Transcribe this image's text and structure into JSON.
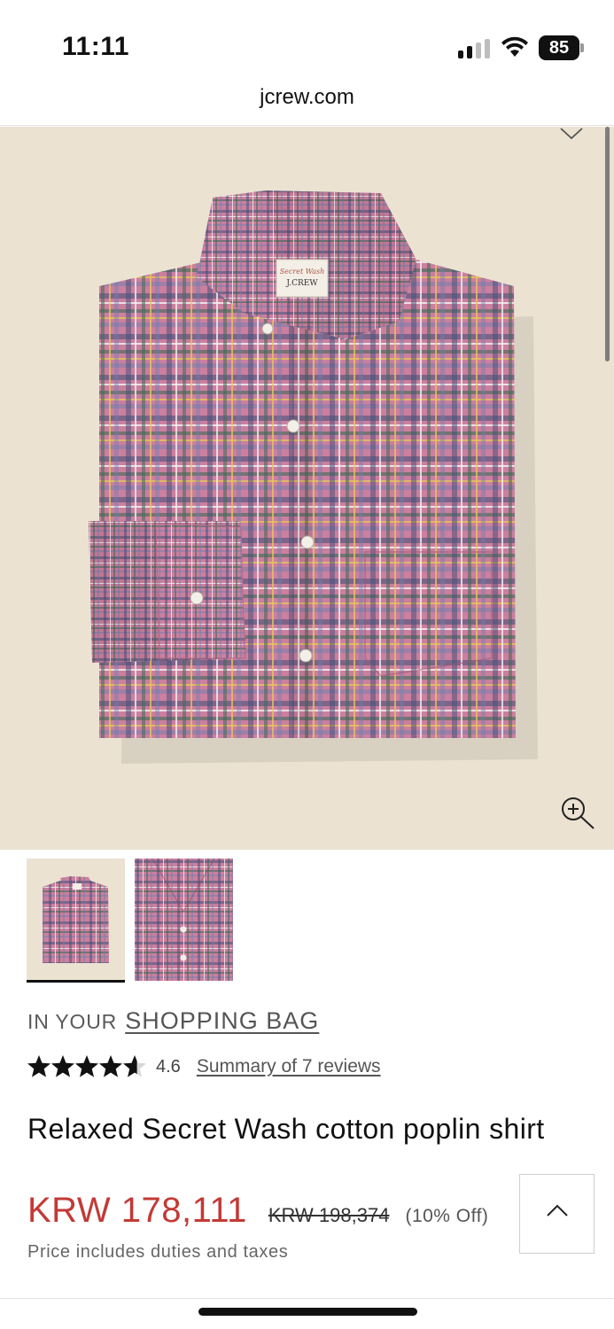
{
  "status_bar": {
    "time": "11:11",
    "battery": "85"
  },
  "browser": {
    "url": "jcrew.com"
  },
  "hero": {
    "label_line1": "Secret Wash",
    "label_line2": "J.CREW",
    "colors": {
      "background": "#ebe2d2",
      "plaid_base": "#cc7f9e",
      "plaid_navy": "#3f4f78",
      "plaid_green": "#3d6b55",
      "plaid_white": "#f4eff0",
      "plaid_yellow": "#e6c65a"
    }
  },
  "thumbnails": [
    {
      "name": "thumbnail-folded",
      "selected": true
    },
    {
      "name": "thumbnail-detail",
      "selected": false
    }
  ],
  "product": {
    "bag_prefix": "IN YOUR",
    "bag_link": "SHOPPING BAG",
    "rating": 4.6,
    "rating_text": "4.6",
    "reviews_link": "Summary of 7 reviews",
    "title": "Relaxed Secret Wash cotton poplin shirt",
    "sale_price": "KRW 178,111",
    "original_price": "KRW 198,374",
    "discount": "(10% Off)",
    "price_note": "Price includes duties and taxes",
    "sale_color": "#c23a36"
  },
  "icons": {
    "wishlist": "heart-outline-icon",
    "zoom": "zoom-in-icon",
    "back_to_top": "chevron-up-icon",
    "star": "star-icon"
  }
}
